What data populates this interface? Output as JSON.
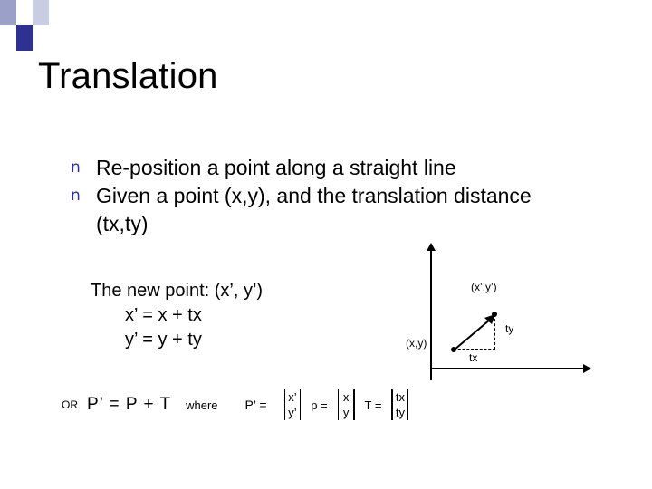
{
  "slide": {
    "title": "Translation",
    "bullets": [
      {
        "marker": "n",
        "text": "Re-position a point along a straight line"
      },
      {
        "marker": "n",
        "text": "Given a point (x,y), and the translation distance (tx,ty)"
      }
    ],
    "new_point": {
      "line1": "The new point: (x’, y’)",
      "line2": "x’ = x + tx",
      "line3": "y’ = y + ty"
    },
    "diagram": {
      "label_xy": "(x,y)",
      "label_xpyp": "(x’,y’)",
      "label_ty": "ty",
      "label_tx": "tx"
    },
    "equation": {
      "or": "OR",
      "formula": "P’  =  P  +  T",
      "where": "where",
      "p_prime_label": "P’ =",
      "p_prime_top": "x’",
      "p_prime_bottom": "y’",
      "p_label": "p =",
      "p_top": "x",
      "p_bottom": "y",
      "t_label": "T =",
      "t_top": "tx",
      "t_bottom": "ty"
    }
  },
  "theme": {
    "accent": "#2e3192",
    "accent_light": "#9aa0c8",
    "accent_pale": "#c9cde2",
    "text": "#000000",
    "background": "#ffffff"
  }
}
